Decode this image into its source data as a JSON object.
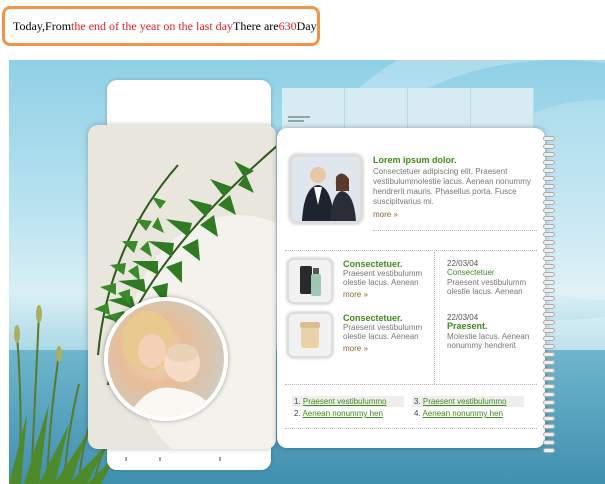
{
  "countdown": {
    "prefix": "Today,From",
    "highlight": "the end of the year on the last day",
    "middle": "There are",
    "days": "630",
    "suffix": "Day"
  },
  "featured": {
    "title": "Lorem ipsum dolor.",
    "body": "Consectetuer adipiscing elit. Praesent vestibulummolestie lacus. Aenean nonummy hendrerit mauris. Phasellus porta. Fusce suscipitvarius mi.",
    "more": "more »"
  },
  "products": [
    {
      "title": "Consectetuer.",
      "body": "Praesent vestibulumm olestie lacus. Aenean",
      "more": "more »"
    },
    {
      "title": "Consectetuer.",
      "body": "Praesent vestibulumm olestie lacus. Aenean",
      "more": "more »"
    }
  ],
  "news": [
    {
      "date": "22/03/04",
      "title": "Consectetuer",
      "body": "Praesent vestibulumm olestie lacus. Aenean"
    },
    {
      "date": "22/03/04",
      "title": "Praesent.",
      "body": "Molestie lacus. Aenean nonummy hendrerit"
    }
  ],
  "links": [
    {
      "num": "1.",
      "text": "Praesent vestibulummo"
    },
    {
      "num": "2.",
      "text": "Aenean nonummy hen"
    },
    {
      "num": "3.",
      "text": "Praesent vestibulummo"
    },
    {
      "num": "4.",
      "text": "Aenean nonummy hen"
    }
  ],
  "colors": {
    "accent_green": "#3f8c1a",
    "countdown_border": "#f0944a",
    "highlight_red": "#e0202a"
  }
}
